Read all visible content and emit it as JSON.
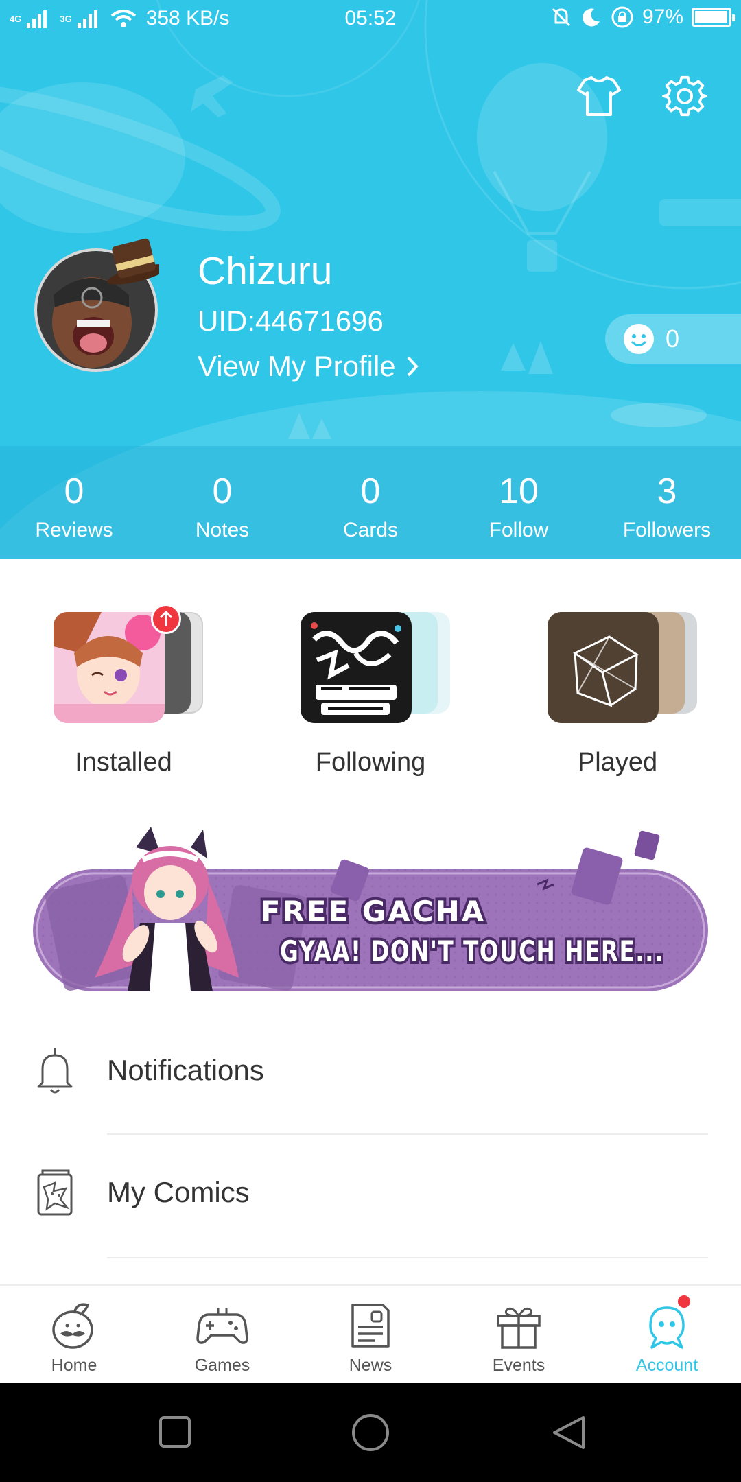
{
  "status_bar": {
    "network_1": "4G",
    "network_2": "3G",
    "speed": "358 KB/s",
    "time": "05:52",
    "battery": "97%",
    "battery_level": 0.97,
    "icons": [
      "signal-icon",
      "wifi-icon",
      "mute-icon",
      "moon-icon",
      "rotation-lock-icon",
      "battery-icon"
    ]
  },
  "header": {
    "shirt_button_icon": "shirt-icon",
    "settings_button_icon": "gear-icon",
    "username": "Chizuru",
    "uid": "UID:44671696",
    "view_profile": "View My Profile",
    "points": "0"
  },
  "stats": [
    {
      "value": "0",
      "label": "Reviews"
    },
    {
      "value": "0",
      "label": "Notes"
    },
    {
      "value": "0",
      "label": "Cards"
    },
    {
      "value": "10",
      "label": "Follow"
    },
    {
      "value": "3",
      "label": "Followers"
    }
  ],
  "collections": [
    {
      "label": "Installed",
      "has_update_badge": true
    },
    {
      "label": "Following",
      "has_update_badge": false
    },
    {
      "label": "Played",
      "has_update_badge": false
    }
  ],
  "banner": {
    "line1": "FREE GACHA",
    "line2": "GYAA! DON'T TOUCH HERE..."
  },
  "menu": [
    {
      "label": "Notifications",
      "icon": "bell-icon"
    },
    {
      "label": "My Comics",
      "icon": "comics-icon"
    }
  ],
  "bottom_nav": [
    {
      "label": "Home",
      "icon": "home-mascot-icon",
      "active": false
    },
    {
      "label": "Games",
      "icon": "gamepad-icon",
      "active": false
    },
    {
      "label": "News",
      "icon": "news-icon",
      "active": false
    },
    {
      "label": "Events",
      "icon": "gift-icon",
      "active": false
    },
    {
      "label": "Account",
      "icon": "account-mascot-icon",
      "active": true
    }
  ],
  "colors": {
    "accent": "#2fc6e8",
    "badge_red": "#f0363f",
    "banner_purple": "#9d74b9"
  }
}
